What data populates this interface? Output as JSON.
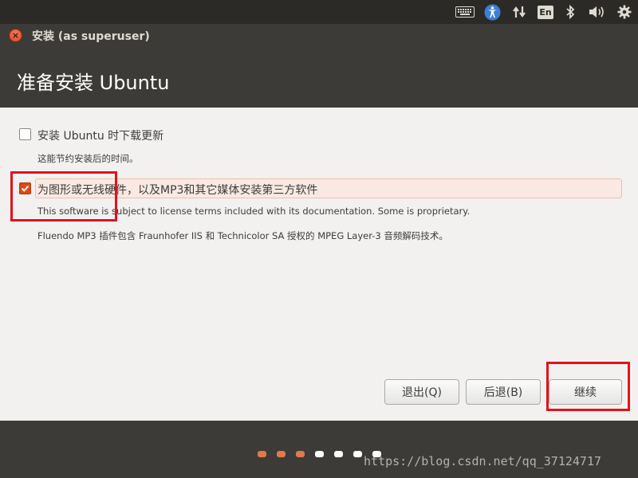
{
  "window": {
    "title": "安装 (as superuser)",
    "close_symbol": "×"
  },
  "panel": {
    "lang": "En"
  },
  "page": {
    "title": "准备安装 Ubuntu"
  },
  "options": [
    {
      "label": "安装 Ubuntu 时下载更新",
      "checked": false,
      "desc": "这能节约安装后的时间。"
    },
    {
      "label": "为图形或无线硬件，以及MP3和其它媒体安装第三方软件",
      "checked": true,
      "desc": "This software is subject to license terms included with its documentation. Some is proprietary.",
      "note": "Fluendo MP3 插件包含 Fraunhofer IIS 和 Technicolor SA 授权的 MPEG Layer-3 音频解码技术。"
    }
  ],
  "buttons": {
    "quit": "退出(Q)",
    "back": "后退(B)",
    "continue": "继续"
  },
  "progress": {
    "total_steps": 7,
    "completed_steps": 3,
    "active_color": "#e07a4b",
    "inactive_color": "#ffffff"
  },
  "watermark": "https://blog.csdn.net/qq_37124717",
  "colors": {
    "accent": "#dd4814",
    "annotation": "#e3121a"
  }
}
